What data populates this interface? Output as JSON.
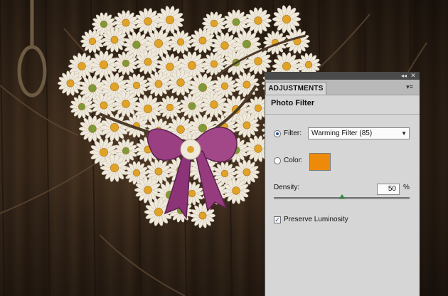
{
  "panel": {
    "tab_label": "ADJUSTMENTS",
    "title": "Photo Filter",
    "collapse_glyph": "◂◂",
    "close_glyph": "✕",
    "menu_glyph": "▾≡"
  },
  "filter": {
    "label": "Filter:",
    "selected": "Warming Filter (85)",
    "selected_state": true
  },
  "color": {
    "label": "Color:",
    "swatch_hex": "#ED8A0A",
    "selected_state": false
  },
  "density": {
    "label": "Density:",
    "value": "50",
    "unit": "%",
    "fraction": 0.5
  },
  "preserve_luminosity": {
    "label": "Preserve Luminosity",
    "checked": true,
    "check_glyph": "✓"
  },
  "icons": [
    "collapse-icon",
    "close-icon",
    "panel-menu-icon",
    "dropdown-arrow-icon",
    "slider-handle-icon"
  ],
  "colors": {
    "panel_bg": "#D6D6D6",
    "radio_dot": "#2B55A0",
    "slider_handle": "#2F8A3A"
  }
}
